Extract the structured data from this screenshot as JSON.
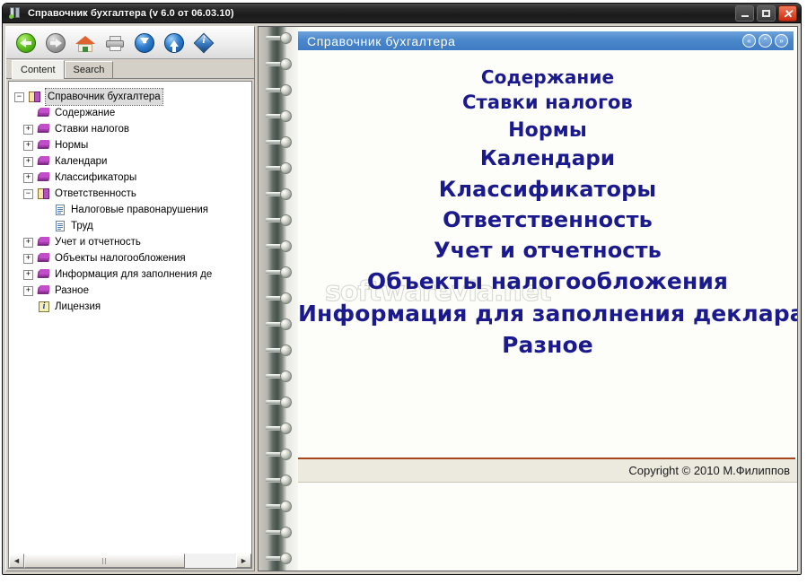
{
  "window": {
    "title": "Справочник бухгалтера  (v 6.0 от 06.03.10)",
    "minimize_label": "",
    "maximize_label": "",
    "close_label": "✕"
  },
  "toolbar": {
    "buttons": [
      {
        "name": "back",
        "title": "Назад"
      },
      {
        "name": "forward",
        "title": "Вперед"
      },
      {
        "name": "home",
        "title": "Домой"
      },
      {
        "name": "print",
        "title": "Печать"
      },
      {
        "name": "down",
        "title": "Вниз"
      },
      {
        "name": "up",
        "title": "Вверх"
      },
      {
        "name": "info",
        "title": "Информация"
      }
    ]
  },
  "tabs": [
    {
      "label": "Content",
      "active": true
    },
    {
      "label": "Search",
      "active": false
    }
  ],
  "tree": {
    "nodes": [
      {
        "label": "Справочник бухгалтера",
        "indent": 0,
        "expander": "minus",
        "icon": "open-book",
        "selected": true
      },
      {
        "label": "Содержание",
        "indent": 1,
        "expander": "none",
        "icon": "book",
        "selected": false
      },
      {
        "label": "Ставки налогов",
        "indent": 1,
        "expander": "plus",
        "icon": "book",
        "selected": false
      },
      {
        "label": "Нормы",
        "indent": 1,
        "expander": "plus",
        "icon": "book",
        "selected": false
      },
      {
        "label": "Календари",
        "indent": 1,
        "expander": "plus",
        "icon": "book",
        "selected": false
      },
      {
        "label": "Классификаторы",
        "indent": 1,
        "expander": "plus",
        "icon": "book",
        "selected": false
      },
      {
        "label": "Ответственность",
        "indent": 1,
        "expander": "minus",
        "icon": "open-book",
        "selected": false
      },
      {
        "label": "Налоговые правонарушения",
        "indent": 2,
        "expander": "none",
        "icon": "page",
        "selected": false
      },
      {
        "label": "Труд",
        "indent": 2,
        "expander": "none",
        "icon": "page",
        "selected": false
      },
      {
        "label": "Учет и отчетность",
        "indent": 1,
        "expander": "plus",
        "icon": "book",
        "selected": false
      },
      {
        "label": "Объекты налогообложения",
        "indent": 1,
        "expander": "plus",
        "icon": "book",
        "selected": false
      },
      {
        "label": "Информация для заполнения де",
        "indent": 1,
        "expander": "plus",
        "icon": "book",
        "selected": false
      },
      {
        "label": "Разное",
        "indent": 1,
        "expander": "plus",
        "icon": "book",
        "selected": false
      },
      {
        "label": "Лицензия",
        "indent": 1,
        "expander": "none",
        "icon": "info",
        "selected": false
      }
    ],
    "expander_plus": "+",
    "expander_minus": "−"
  },
  "left_scrollbar": {
    "left_arrow": "◄",
    "right_arrow": "►"
  },
  "content": {
    "header_title": "Справочник  бухгалтера",
    "header_nav": [
      {
        "name": "prev-page",
        "glyph": "«"
      },
      {
        "name": "up-page",
        "glyph": "⌃"
      },
      {
        "name": "next-page",
        "glyph": "»"
      }
    ],
    "menu_items": [
      {
        "label": "Содержание",
        "size": 20
      },
      {
        "label": "Ставки налогов",
        "size": 21
      },
      {
        "label": "Нормы",
        "size": 22
      },
      {
        "label": "Календари",
        "size": 23
      },
      {
        "label": "Классификаторы",
        "size": 24
      },
      {
        "label": "Ответственность",
        "size": 24
      },
      {
        "label": "Учет и отчетность",
        "size": 24
      },
      {
        "label": "Объекты налогообложения",
        "size": 25
      },
      {
        "label": "Информация для заполнения деклараций",
        "size": 25
      },
      {
        "label": "Разное",
        "size": 25
      }
    ],
    "watermark": "softwarevia.net",
    "footer": "Copyright © 2010 М.Филиппов"
  },
  "colors": {
    "accent_blue": "#3f7cc3",
    "menu_text": "#1a1a8e",
    "rule": "#a8471e",
    "footer_bg": "#ece9df",
    "close_red": "#cc2b10"
  }
}
